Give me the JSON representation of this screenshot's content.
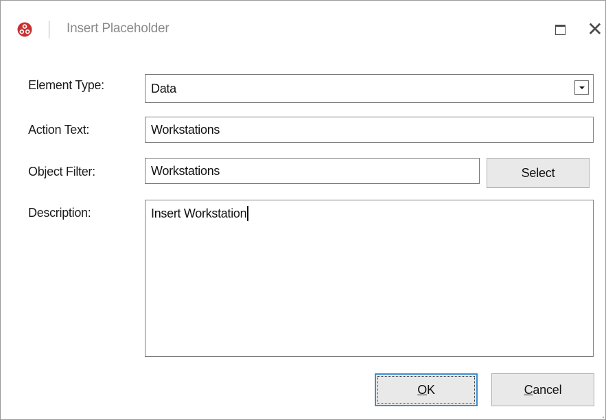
{
  "window": {
    "title": "Insert Placeholder",
    "app_icon": "app-logo-icon",
    "maximize_icon": "maximize-icon",
    "close_glyph": "✕"
  },
  "form": {
    "element_type": {
      "label": "Element Type:",
      "value": "Data"
    },
    "action_text": {
      "label": "Action Text:",
      "value": "Workstations"
    },
    "object_filter": {
      "label": "Object Filter:",
      "value": "Workstations",
      "button": "Select"
    },
    "description": {
      "label": "Description:",
      "value": "Insert Workstation"
    }
  },
  "buttons": {
    "ok": {
      "mnemonic": "O",
      "rest": "K"
    },
    "cancel": {
      "mnemonic": "C",
      "rest": "ancel"
    }
  },
  "colors": {
    "app_icon_red": "#c8312f",
    "focus_border": "#3c8fd4",
    "button_face": "#e9e9e9"
  }
}
